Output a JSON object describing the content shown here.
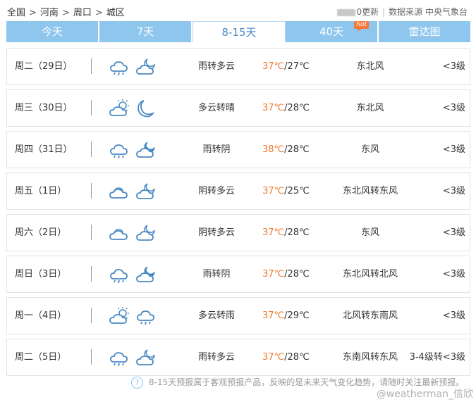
{
  "breadcrumb": [
    "全国",
    "河南",
    "周口",
    "城区"
  ],
  "breadcrumb_sep": ">",
  "top_right": {
    "update_text": "0更新",
    "divider": "|",
    "source_label": "数据来源 中央气象台"
  },
  "tabs": [
    {
      "label": "今天",
      "active": false
    },
    {
      "label": "7天",
      "active": false
    },
    {
      "label": "8-15天",
      "active": true
    },
    {
      "label": "40天",
      "active": false,
      "badge": "hot"
    },
    {
      "label": "雷达图",
      "active": false
    }
  ],
  "colors": {
    "tab_bg": "#8fc6ee",
    "tab_active_text": "#4a8ac4",
    "high_temp": "#f1792d",
    "icon_stroke": "#4a8ac4"
  },
  "days": [
    {
      "date": "周二（29日）",
      "icons": [
        "rain-cloud-icon",
        "partly-cloudy-night-icon"
      ],
      "desc": "雨转多云",
      "high": "37℃",
      "low": "/27℃",
      "wind": "东北风",
      "level": "<3级"
    },
    {
      "date": "周三（30日）",
      "icons": [
        "partly-cloudy-day-icon",
        "crescent-moon-icon"
      ],
      "desc": "多云转晴",
      "high": "37℃",
      "low": "/28℃",
      "wind": "东北风",
      "level": "<3级"
    },
    {
      "date": "周四（31日）",
      "icons": [
        "rain-cloud-icon",
        "overcast-night-icon"
      ],
      "desc": "雨转阴",
      "high": "38℃",
      "low": "/28℃",
      "wind": "东风",
      "level": "<3级"
    },
    {
      "date": "周五（1日）",
      "icons": [
        "overcast-icon",
        "partly-cloudy-night-icon"
      ],
      "desc": "阴转多云",
      "high": "37℃",
      "low": "/25℃",
      "wind": "东北风转东风",
      "level": "<3级"
    },
    {
      "date": "周六（2日）",
      "icons": [
        "overcast-icon",
        "partly-cloudy-night-icon"
      ],
      "desc": "阴转多云",
      "high": "37℃",
      "low": "/28℃",
      "wind": "东风",
      "level": "<3级"
    },
    {
      "date": "周日（3日）",
      "icons": [
        "rain-cloud-icon",
        "overcast-night-icon"
      ],
      "desc": "雨转阴",
      "high": "37℃",
      "low": "/28℃",
      "wind": "东北风转北风",
      "level": "<3级"
    },
    {
      "date": "周一（4日）",
      "icons": [
        "partly-cloudy-day-icon",
        "rain-cloud-icon"
      ],
      "desc": "多云转雨",
      "high": "37℃",
      "low": "/29℃",
      "wind": "北风转东南风",
      "level": "<3级"
    },
    {
      "date": "周二（5日）",
      "icons": [
        "rain-cloud-icon",
        "partly-cloudy-night-icon"
      ],
      "desc": "雨转多云",
      "high": "37℃",
      "low": "/28℃",
      "wind": "东南风转东风",
      "level": "3-4级转<3级"
    }
  ],
  "footnote": {
    "icon": "question-icon",
    "icon_glyph": "?",
    "text": "8-15天预报属于客观预报产品，反映的是未来天气变化趋势，请随时关注最新预报。"
  },
  "watermark": "@weatherman_信欣"
}
